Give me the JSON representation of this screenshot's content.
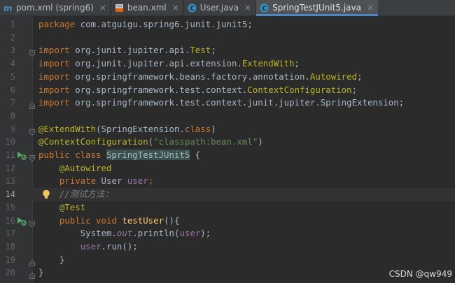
{
  "tabs": [
    {
      "label": "pom.xml (spring6)",
      "icon": "maven-icon",
      "active": false
    },
    {
      "label": "bean.xml",
      "icon": "xml-file-icon",
      "active": false
    },
    {
      "label": "User.java",
      "icon": "java-class-icon",
      "active": false
    },
    {
      "label": "SpringTestJUnit5.java",
      "icon": "java-class-icon",
      "active": true
    }
  ],
  "tab_close_glyph": "×",
  "editor": {
    "current_line": 14,
    "lines": [
      {
        "n": "1",
        "t": [
          {
            "c": "kw",
            "v": "package "
          },
          {
            "c": "",
            "v": "com.atguigu.spring6.junit.junit5;"
          }
        ]
      },
      {
        "n": "2",
        "t": []
      },
      {
        "n": "3",
        "t": [
          {
            "c": "kw",
            "v": "import "
          },
          {
            "c": "",
            "v": "org.junit.jupiter.api."
          },
          {
            "c": "ann",
            "v": "Test"
          },
          {
            "c": "",
            "v": ";"
          }
        ]
      },
      {
        "n": "4",
        "t": [
          {
            "c": "kw",
            "v": "import "
          },
          {
            "c": "",
            "v": "org.junit.jupiter.api.extension."
          },
          {
            "c": "ann",
            "v": "ExtendWith"
          },
          {
            "c": "",
            "v": ";"
          }
        ]
      },
      {
        "n": "5",
        "t": [
          {
            "c": "kw",
            "v": "import "
          },
          {
            "c": "",
            "v": "org.springframework.beans.factory.annotation."
          },
          {
            "c": "ann",
            "v": "Autowired"
          },
          {
            "c": "",
            "v": ";"
          }
        ]
      },
      {
        "n": "6",
        "t": [
          {
            "c": "kw",
            "v": "import "
          },
          {
            "c": "",
            "v": "org.springframework.test.context."
          },
          {
            "c": "ann",
            "v": "ContextConfiguration"
          },
          {
            "c": "",
            "v": ";"
          }
        ]
      },
      {
        "n": "7",
        "t": [
          {
            "c": "kw",
            "v": "import "
          },
          {
            "c": "",
            "v": "org.springframework.test.context.junit.jupiter.SpringExtension;"
          }
        ]
      },
      {
        "n": "8",
        "t": []
      },
      {
        "n": "9",
        "t": [
          {
            "c": "ann",
            "v": "@ExtendWith"
          },
          {
            "c": "",
            "v": "(SpringExtension."
          },
          {
            "c": "kw",
            "v": "class"
          },
          {
            "c": "",
            "v": ")"
          }
        ]
      },
      {
        "n": "10",
        "t": [
          {
            "c": "ann",
            "v": "@ContextConfiguration"
          },
          {
            "c": "",
            "v": "("
          },
          {
            "c": "str",
            "v": "\"classpath:bean.xml\""
          },
          {
            "c": "",
            "v": ")"
          }
        ]
      },
      {
        "n": "11",
        "t": [
          {
            "c": "kw",
            "v": "public class "
          },
          {
            "c": "cls-hl",
            "v": "SpringTestJUnit5"
          },
          {
            "c": "",
            "v": " {"
          }
        ]
      },
      {
        "n": "12",
        "t": [
          {
            "c": "",
            "v": "    "
          },
          {
            "c": "ann",
            "v": "@Autowired"
          }
        ]
      },
      {
        "n": "13",
        "t": [
          {
            "c": "",
            "v": "    "
          },
          {
            "c": "kw",
            "v": "private "
          },
          {
            "c": "",
            "v": "User "
          },
          {
            "c": "fld",
            "v": "user"
          },
          {
            "c": "kw",
            "v": ";"
          }
        ]
      },
      {
        "n": "14",
        "t": [
          {
            "c": "",
            "v": "    "
          },
          {
            "c": "cmt",
            "v": "//测试方法："
          }
        ]
      },
      {
        "n": "15",
        "t": [
          {
            "c": "",
            "v": "    "
          },
          {
            "c": "ann",
            "v": "@Test"
          }
        ]
      },
      {
        "n": "16",
        "t": [
          {
            "c": "",
            "v": "    "
          },
          {
            "c": "kw",
            "v": "public void "
          },
          {
            "c": "fn",
            "v": "testUser"
          },
          {
            "c": "",
            "v": "(){"
          }
        ]
      },
      {
        "n": "17",
        "t": [
          {
            "c": "",
            "v": "        System."
          },
          {
            "c": "stat",
            "v": "out"
          },
          {
            "c": "",
            "v": ".println("
          },
          {
            "c": "fld",
            "v": "user"
          },
          {
            "c": "",
            "v": ");"
          }
        ]
      },
      {
        "n": "18",
        "t": [
          {
            "c": "",
            "v": "        "
          },
          {
            "c": "fld",
            "v": "user"
          },
          {
            "c": "",
            "v": ".run();"
          }
        ]
      },
      {
        "n": "19",
        "t": [
          {
            "c": "",
            "v": "    }"
          }
        ]
      },
      {
        "n": "20",
        "t": [
          {
            "c": "",
            "v": "}"
          }
        ]
      }
    ],
    "run_gutter_lines": [
      11,
      16
    ],
    "fold_lines": {
      "3": "open",
      "7": "close",
      "9": "open",
      "11": "open",
      "16": "open",
      "19": "close",
      "20": "close"
    },
    "intention_bulb_line": 14
  },
  "watermark": "CSDN @qw949",
  "colors": {
    "background": "#2b2b2b",
    "keyword": "#cc7832",
    "annotation": "#bbb529",
    "string": "#6a8759",
    "field": "#9876aa",
    "method": "#ffc66d",
    "comment": "#808080",
    "tab_accent": "#4a88c7",
    "run_icon": "#59a869",
    "bulb": "#f2c55c"
  }
}
